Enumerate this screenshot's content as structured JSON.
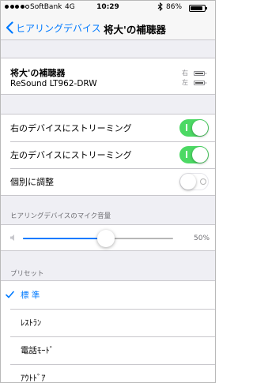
{
  "status_bar": {
    "carrier": "SoftBank",
    "network": "4G",
    "time": "10:29",
    "bluetooth_icon": "bluetooth-icon",
    "battery_percent": "86%",
    "battery_level": 0.86
  },
  "nav": {
    "back_label": "ヒアリングデバイス",
    "title": "将大'の補聴器"
  },
  "device": {
    "name": "将大'の補聴器",
    "model": "ReSound LT962-DRW",
    "right_label": "右",
    "left_label": "左"
  },
  "streaming": {
    "right": {
      "label": "右のデバイスにストリーミング",
      "on": true
    },
    "left": {
      "label": "左のデバイスにストリーミング",
      "on": true
    },
    "separate": {
      "label": "個別に調整",
      "on": false
    }
  },
  "mic": {
    "header": "ヒアリングデバイスのマイク音量",
    "value_label": "50%",
    "value": 0.55
  },
  "presets": {
    "header": "プリセット",
    "items": [
      {
        "label": "標 準",
        "selected": true
      },
      {
        "label": "ﾚｽﾄﾗﾝ",
        "selected": false
      },
      {
        "label": "電話ﾓｰﾄﾞ",
        "selected": false
      },
      {
        "label": "ｱｳﾄﾄﾞｱ",
        "selected": false
      }
    ]
  },
  "colors": {
    "accent": "#007aff",
    "toggle_on": "#4cd964",
    "group_background": "#efeff4"
  }
}
